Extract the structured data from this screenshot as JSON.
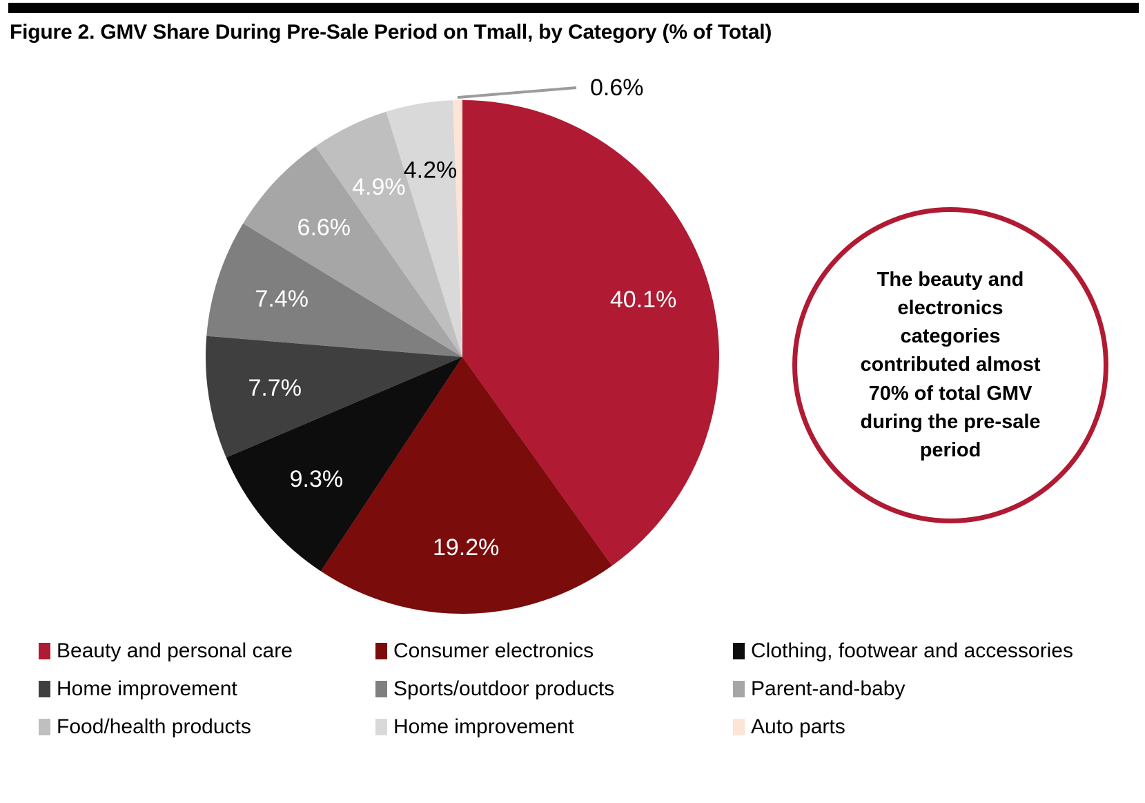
{
  "figure": {
    "title": "Figure 2. GMV Share During Pre-Sale Period on Tmall, by Category (% of Total)"
  },
  "annotation": {
    "text": "The beauty and electronics categories contributed almost 70% of total GMV during the pre-sale period",
    "border_color": "#B01A32"
  },
  "legend": {
    "rows": [
      [
        {
          "label": "Beauty and personal care",
          "color": "#B01A32"
        },
        {
          "label": "Consumer electronics",
          "color": "#7B0C0C"
        },
        {
          "label": "Clothing, footwear and accessories",
          "color": "#0D0D0D"
        }
      ],
      [
        {
          "label": "Home improvement",
          "color": "#3F3F3F"
        },
        {
          "label": "Sports/outdoor products",
          "color": "#7F7F7F"
        },
        {
          "label": "Parent-and-baby",
          "color": "#A6A6A6"
        }
      ],
      [
        {
          "label": "Food/health products",
          "color": "#BFBFBF"
        },
        {
          "label": "Home improvement",
          "color": "#D9D9D9"
        },
        {
          "label": "Auto parts",
          "color": "#FCE4D6"
        }
      ]
    ]
  },
  "chart_data": {
    "type": "pie",
    "title": "Figure 2. GMV Share During Pre-Sale Period on Tmall, by Category (% of Total)",
    "unit": "% of Total",
    "legend_position": "bottom",
    "start_angle_deg": 0,
    "direction": "clockwise",
    "categories": [
      "Beauty and personal care",
      "Consumer electronics",
      "Clothing, footwear and accessories",
      "Home improvement",
      "Sports/outdoor products",
      "Parent-and-baby",
      "Food/health products",
      "Home improvement",
      "Auto parts"
    ],
    "values": [
      40.1,
      19.2,
      9.3,
      7.7,
      7.4,
      6.6,
      4.9,
      4.2,
      0.6
    ],
    "labels": [
      "40.1%",
      "19.2%",
      "9.3%",
      "7.7%",
      "7.4%",
      "6.6%",
      "4.9%",
      "4.2%",
      "0.6%"
    ],
    "colors": [
      "#B01A32",
      "#7B0C0C",
      "#0D0D0D",
      "#3F3F3F",
      "#7F7F7F",
      "#A6A6A6",
      "#BFBFBF",
      "#D9D9D9",
      "#FCE4D6"
    ],
    "label_text_colors": [
      "#FFFFFF",
      "#FFFFFF",
      "#FFFFFF",
      "#FFFFFF",
      "#FFFFFF",
      "#FFFFFF",
      "#FFFFFF",
      "#000000",
      "#000000"
    ],
    "leader_line_slices": [
      "Auto parts"
    ]
  }
}
